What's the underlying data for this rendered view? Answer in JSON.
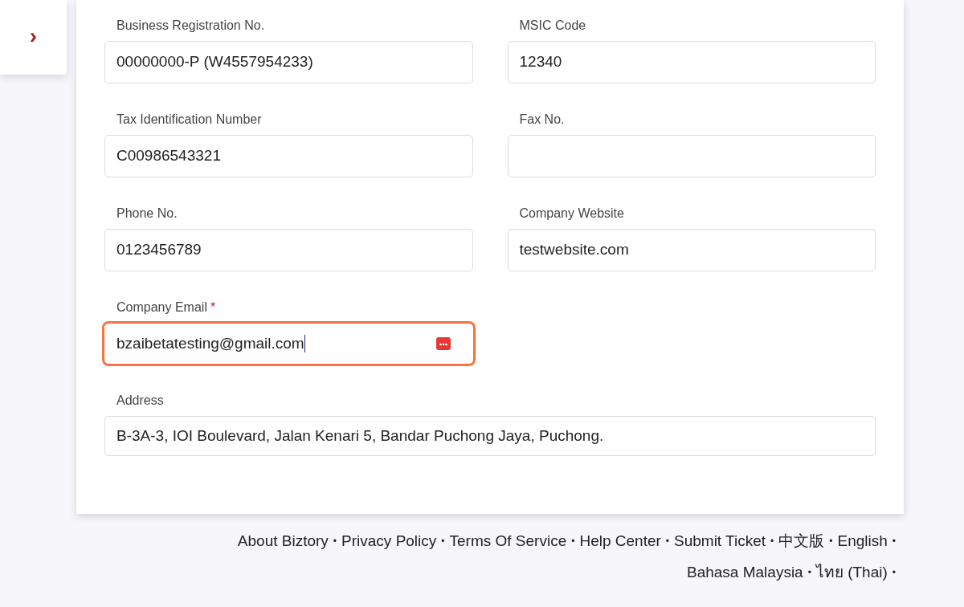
{
  "sidebar_toggle": {
    "icon": "›"
  },
  "form": {
    "rows": [
      {
        "kind": "pair",
        "fields": [
          {
            "label": "Business Registration No.",
            "value": "00000000-P (W4557954233)",
            "focused": false
          },
          {
            "label": "MSIC Code",
            "value": "12340",
            "focused": false
          }
        ]
      },
      {
        "kind": "pair",
        "fields": [
          {
            "label": "Tax Identification Number",
            "value": "C00986543321",
            "focused": false
          },
          {
            "label": "Fax No.",
            "focused": false
          }
        ]
      },
      {
        "kind": "pair",
        "fields": [
          {
            "label": "Phone No.",
            "value": "0123456789",
            "focused": false
          },
          {
            "label": "Company Website",
            "value": "testwebsite.com",
            "focused": false
          }
        ]
      },
      {
        "kind": "single",
        "fields": [
          {
            "label": "Company Email",
            "value": "bzaibetatesting@gmail.com",
            "required_mark": "*",
            "focused": true
          }
        ]
      },
      {
        "kind": "wide",
        "fields": [
          {
            "label": "Address",
            "value": "B-3A-3, IOI Boulevard, Jalan Kenari 5, Bandar Puchong Jaya, Puchong.",
            "focused": false
          }
        ]
      }
    ]
  },
  "footer": {
    "separator": "•",
    "lines": [
      [
        "About Biztory",
        "Privacy Policy",
        "Terms Of Service",
        "Help Center",
        "Submit Ticket",
        "中文版",
        "English"
      ],
      [
        "Bahasa Malaysia",
        "ไทย (Thai)"
      ]
    ]
  }
}
